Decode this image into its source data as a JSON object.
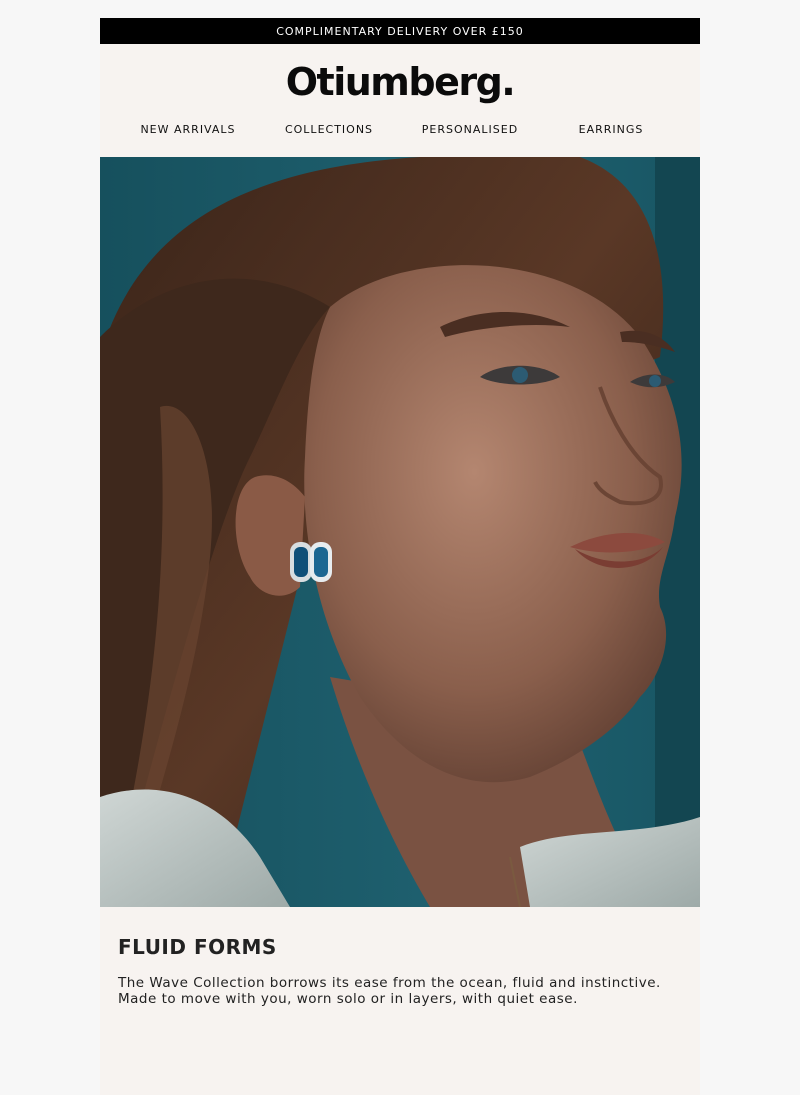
{
  "promo": {
    "text": "COMPLIMENTARY DELIVERY OVER £150"
  },
  "brand": {
    "logo_text": "Otiumberg."
  },
  "nav": {
    "items": [
      {
        "label": "NEW ARRIVALS"
      },
      {
        "label": "COLLECTIONS"
      },
      {
        "label": "PERSONALISED"
      },
      {
        "label": "EARRINGS"
      }
    ]
  },
  "hero": {
    "image": "portrait-woman-wearing-blue-stone-hoop-earring"
  },
  "section": {
    "headline": "FLUID FORMS",
    "body": "The Wave Collection borrows its ease from the ocean, fluid and instinctive. Made to move with you, worn solo or in layers, with quiet ease."
  },
  "colors": {
    "promo_bg": "#000000",
    "header_bg": "#f7f3f0",
    "page_bg": "#f7f7f7",
    "hero_bg": "#1d5866"
  }
}
